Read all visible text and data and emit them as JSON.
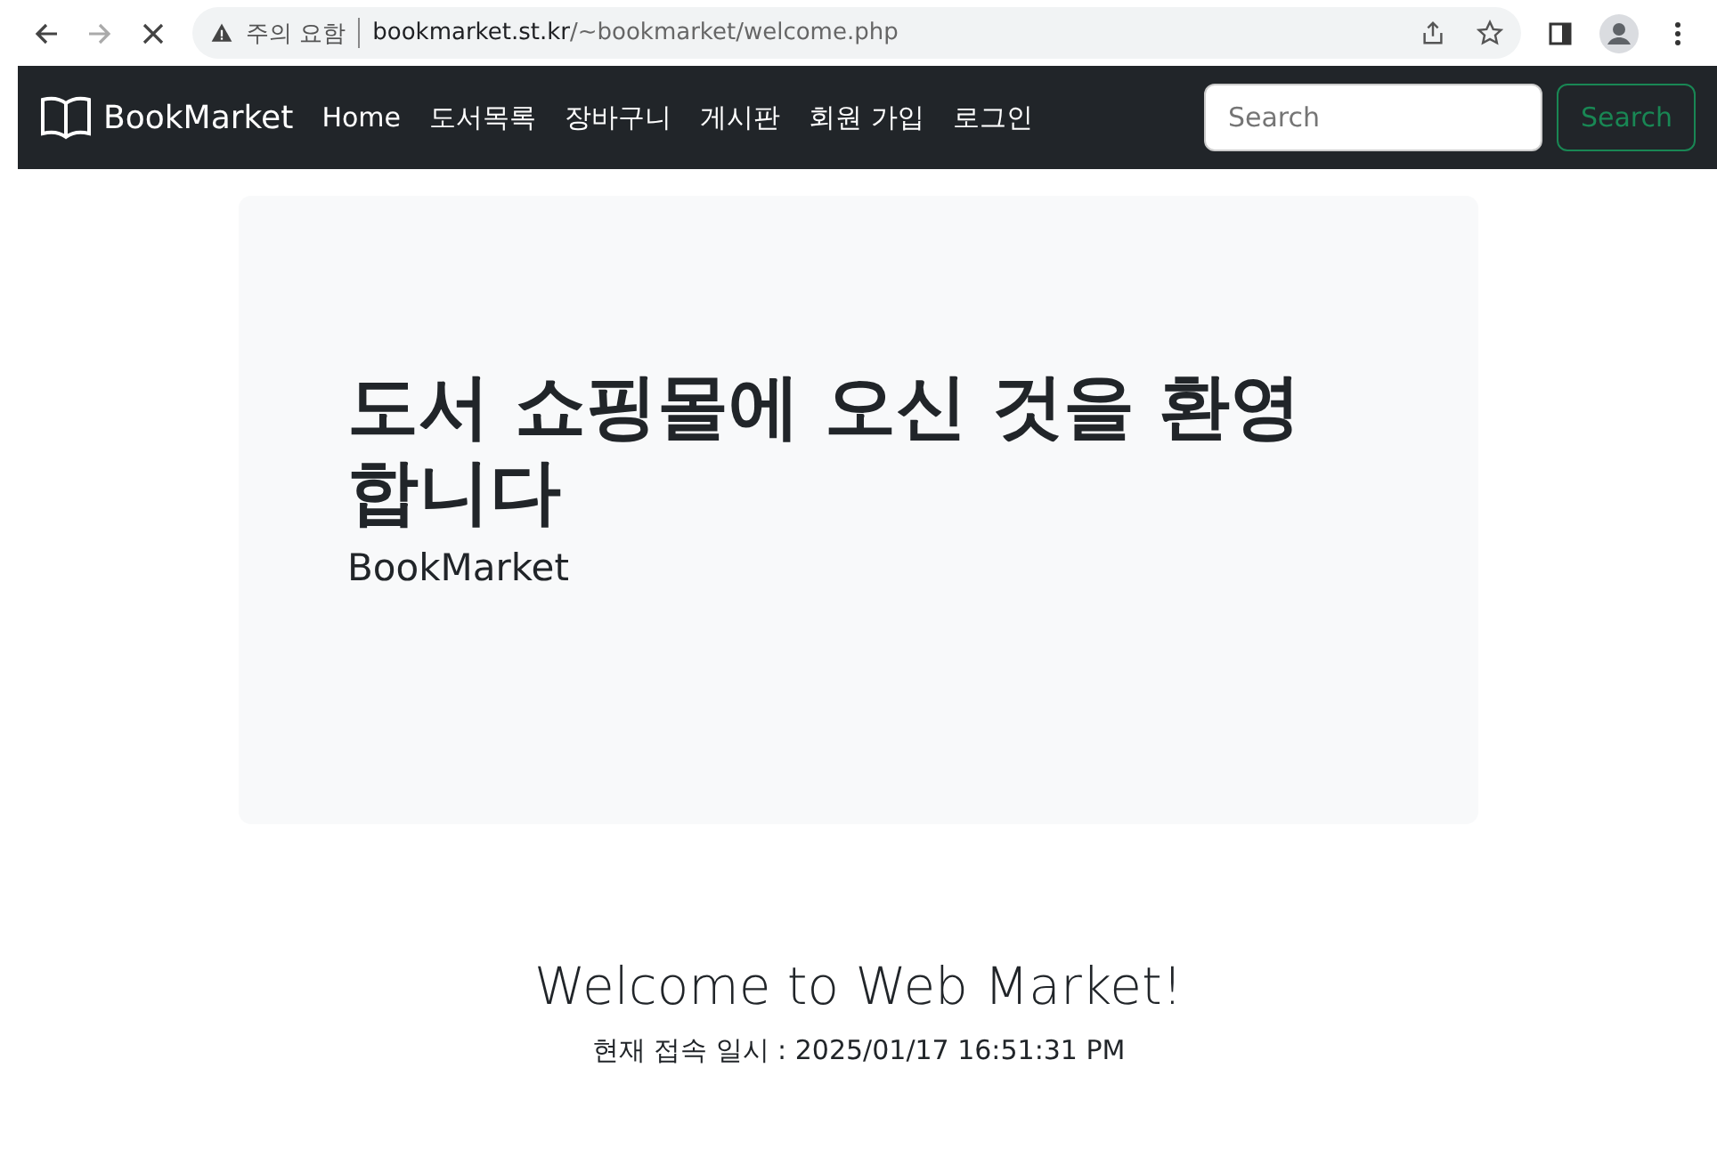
{
  "browser": {
    "security_label": "주의 요함",
    "url_host": "bookmarket.st.kr",
    "url_path": "/~bookmarket/welcome.php"
  },
  "navbar": {
    "brand": "BookMarket",
    "links": [
      {
        "label": "Home"
      },
      {
        "label": "도서목록"
      },
      {
        "label": "장바구니"
      },
      {
        "label": "게시판"
      },
      {
        "label": "회원 가입"
      },
      {
        "label": "로그인"
      }
    ],
    "search": {
      "placeholder": "Search",
      "button": "Search"
    }
  },
  "hero": {
    "title": "도서 쇼핑몰에 오신 것을 환영합니다",
    "subtitle": "BookMarket"
  },
  "welcome": {
    "title": "Welcome to Web Market!",
    "timestamp": "현재 접속 일시 : 2025/01/17 16:51:31 PM"
  }
}
